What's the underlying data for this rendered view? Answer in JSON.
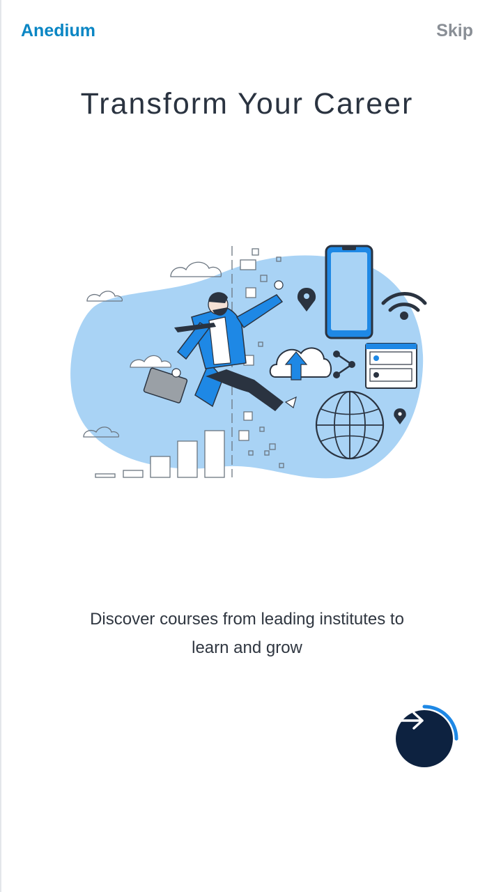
{
  "header": {
    "brand": "Anedium",
    "skip_label": "Skip"
  },
  "onboarding": {
    "title": "Transform Your Career",
    "description_line1": "Discover courses from leading institutes to",
    "description_line2": "learn and grow",
    "illustration_icon": "career-growth-illustration",
    "next_icon": "arrow-right-icon",
    "progress": 0.25
  },
  "colors": {
    "brand": "#0a86c4",
    "accent": "#1e88e5",
    "blob": "#a9d3f5",
    "button_bg": "#0d2240"
  }
}
